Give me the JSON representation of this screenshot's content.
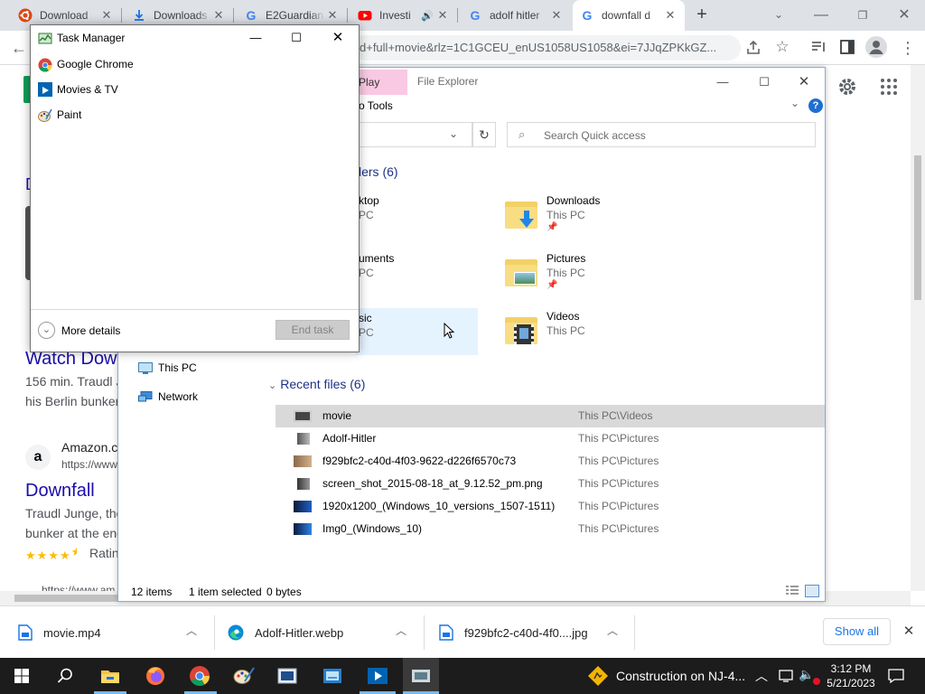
{
  "chrome": {
    "tabs": [
      {
        "title": "Download ",
        "active": false
      },
      {
        "title": "Downloads",
        "active": false
      },
      {
        "title": "E2Guardian",
        "active": false
      },
      {
        "title": "Investi",
        "active": false
      },
      {
        "title": "adolf hitler",
        "active": false
      },
      {
        "title": "downfall d",
        "active": true
      }
    ],
    "url": "d+full+movie&rlz=1C1GCEU_enUS1058US1058&ei=7JJqZPKkGZ..."
  },
  "page": {
    "results": [
      {
        "title": "Watch Dow",
        "snippet1": "156 min. Traudl J",
        "snippet2": "his Berlin bunker"
      },
      {
        "site": "Amazon.c",
        "url": "https://www",
        "title": "Downfall",
        "snippet1": "Traudl Junge, the",
        "snippet2": "bunker at the end",
        "rating_label": "Ratin",
        "stars": 4.5
      }
    ],
    "partial_url": "https://www.am"
  },
  "explorer": {
    "title": "File Explorer",
    "ribbon_tab_play": "Play",
    "ribbon_tab_tools": "o Tools",
    "search_placeholder": "Search Quick access",
    "frequent_header": "lers (6)",
    "frequent": [
      {
        "name": "ktop",
        "sub": "PC",
        "pinned": false
      },
      {
        "name": "Downloads",
        "sub": "This PC",
        "pinned": true
      },
      {
        "name": "uments",
        "sub": "PC",
        "pinned": false
      },
      {
        "name": "Pictures",
        "sub": "This PC",
        "pinned": true
      },
      {
        "name": "sic",
        "sub": "PC",
        "pinned": false
      },
      {
        "name": "Videos",
        "sub": "This PC",
        "pinned": false
      }
    ],
    "nav": [
      {
        "label": "This PC"
      },
      {
        "label": "Network"
      }
    ],
    "recent_header": "Recent files (6)",
    "recent": [
      {
        "name": "movie",
        "location": "This PC\\Videos"
      },
      {
        "name": "Adolf-Hitler",
        "location": "This PC\\Pictures"
      },
      {
        "name": "f929bfc2-c40d-4f03-9622-d226f6570c73",
        "location": "This PC\\Pictures"
      },
      {
        "name": "screen_shot_2015-08-18_at_9.12.52_pm.png",
        "location": "This PC\\Pictures"
      },
      {
        "name": "1920x1200_(Windows_10_versions_1507-1511)",
        "location": "This PC\\Pictures"
      },
      {
        "name": "Img0_(Windows_10)",
        "location": "This PC\\Pictures"
      }
    ],
    "status": {
      "items": "12 items",
      "selected": "1 item selected",
      "size": "0 bytes"
    }
  },
  "taskmanager": {
    "title": "Task Manager",
    "apps": [
      {
        "name": "Google Chrome"
      },
      {
        "name": "Movies & TV"
      },
      {
        "name": "Paint"
      }
    ],
    "more_details": "More details",
    "end_task": "End task"
  },
  "downloads": {
    "items": [
      {
        "name": "movie.mp4"
      },
      {
        "name": "Adolf-Hitler.webp"
      },
      {
        "name": "f929bfc2-c40d-4f0....jpg"
      }
    ],
    "show_all": "Show all"
  },
  "taskbar": {
    "notification": "Construction on NJ-4...",
    "time": "3:12 PM",
    "date": "5/21/2023"
  },
  "colors": {
    "taskbar": "#1c1c1c",
    "selection": "#cce8ff",
    "chrome_tabstrip": "#dee1e6",
    "link": "#1a0dab"
  }
}
